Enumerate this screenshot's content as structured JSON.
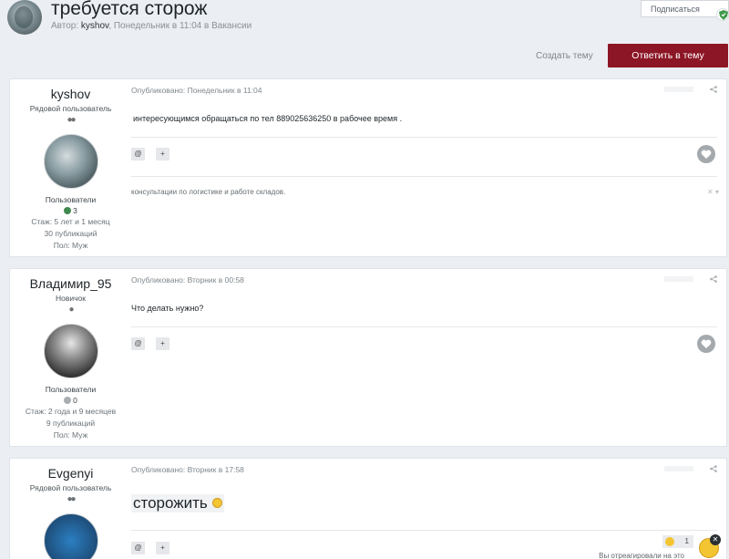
{
  "topic": {
    "title": "требуется сторож",
    "meta_prefix": "Автор: ",
    "author": "kyshov",
    "meta_suffix": ", Понедельник в 11:04 в Вакансии",
    "follow_label": "Подписаться"
  },
  "actions": {
    "create_topic": "Создать тему",
    "reply": "Ответить в тему"
  },
  "posts": [
    {
      "author": "kyshov",
      "rank": "Рядовой пользователь",
      "group": "Пользователи",
      "reputation": "3",
      "experience": "Стаж: 5 лет и 1 месяц",
      "posts_count": "30 публикаций",
      "gender": "Пол: Муж",
      "date": "Опубликовано: Понедельник в 11:04",
      "text": "интересующимся обращаться по тел 889025636250 в рабочее время .",
      "signature": "консультации по логистике и работе складов."
    },
    {
      "author": "Владимир_95",
      "rank": "Новичок",
      "group": "Пользователи",
      "reputation": "0",
      "experience": "Стаж: 2 года и 9 месяцев",
      "posts_count": "9 публикаций",
      "gender": "Пол: Муж",
      "date": "Опубликовано: Вторник в 00:58",
      "text": "Что делать нужно?"
    },
    {
      "author": "Evgenyi",
      "rank": "Рядовой пользователь",
      "date": "Опубликовано: Вторник в 17:58",
      "text": "сторожить",
      "reaction_count": "1",
      "reaction_note": "Вы отреагировали на это"
    }
  ],
  "colors": {
    "accent": "#8c1625",
    "reputation_positive": "#3f8a4e",
    "reputation_neutral": "#a8adb1"
  },
  "icons": {
    "share": "share-icon",
    "quote": "quote-icon",
    "multiquote": "plus-icon",
    "like": "heart-icon"
  }
}
